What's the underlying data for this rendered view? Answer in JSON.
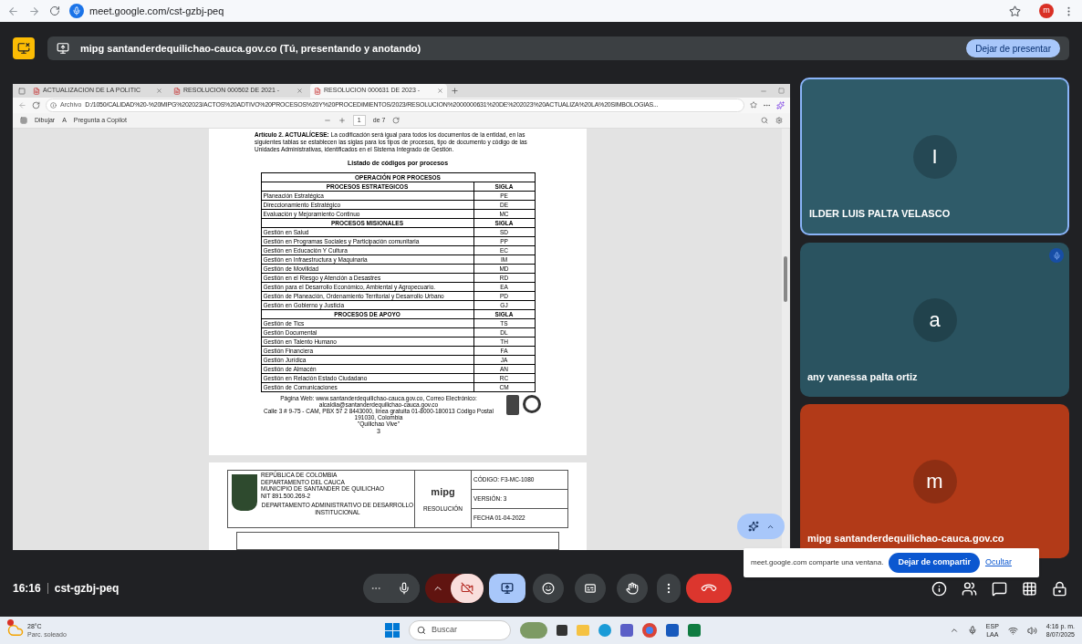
{
  "browser": {
    "url": "meet.google.com/cst-gzbj-peq",
    "profile_initial": "m"
  },
  "presenting_bar": {
    "text": "mipg santanderdequilichao-cauca.gov.co (Tú, presentando y anotando)",
    "button": "Dejar de presentar"
  },
  "shared_window": {
    "tabs": [
      {
        "label": "ACTUALIZACION DE LA POLITIC",
        "selected": false
      },
      {
        "label": "RESOLUCION 000502 DE 2021 -",
        "selected": false
      },
      {
        "label": "RESOLUCION 000631 DE 2023 -",
        "selected": true
      }
    ],
    "address_label": "Archivo",
    "address": "D:/1050/CALIDAD%20-%20MIPG%202023/ACTOS%20ADTIVO%20PROCESOS%20Y%20PROCEDIMIENTOS/2023/RESOLUCION%2000000631%20DE%202023%20ACTUALIZA%20LA%20SIMBOLOGIAS...",
    "pdf_toolbar": {
      "draw": "Dibujar",
      "read_aloud": "A",
      "copilot": "Pregunta a Copilot",
      "page": "1",
      "page_count": "de 7"
    },
    "page": {
      "intro": "**Artículo 2. ACTUALÍCESE:** La codificación será igual para todos los documentos de la entidad, en las siguientes tablas se establecen las siglas para los tipos de procesos, tipo de documento y código de las Unidades Administrativas, identificados en el Sistema Integrado de Gestión.",
      "heading": "Listado de códigos por procesos",
      "table_title": "OPERACIÓN POR PROCESOS",
      "sections": [
        {
          "name": "PROCESOS ESTRATEGICOS",
          "code_header": "SIGLA",
          "rows": [
            {
              "name": "Planeación Estratégica",
              "code": "PE"
            },
            {
              "name": "Direccionamiento Estratégico",
              "code": "DE"
            },
            {
              "name": "Evaluación y Mejoramiento Continuo",
              "code": "MC"
            }
          ]
        },
        {
          "name": "PROCESOS MISIONALES",
          "code_header": "SIGLA",
          "rows": [
            {
              "name": "Gestión en Salud",
              "code": "SD"
            },
            {
              "name": "Gestión en Programas Sociales y Participación comunitaria",
              "code": "PP"
            },
            {
              "name": "Gestión en Educación Y Cultura",
              "code": "EC"
            },
            {
              "name": "Gestión en Infraestructura y Maquinaria",
              "code": "IM"
            },
            {
              "name": "Gestión de Movilidad",
              "code": "MD"
            },
            {
              "name": "Gestión en el Riesgo y Atención a Desastres",
              "code": "RD"
            },
            {
              "name": "Gestión para el Desarrollo Económico, Ambiental y Agropecuario.",
              "code": "EA"
            },
            {
              "name": "Gestión de Planeación, Ordenamiento Territorial y Desarrollo Urbano",
              "code": "PD"
            },
            {
              "name": "Gestión en Gobierno y Justicia",
              "code": "GJ"
            }
          ]
        },
        {
          "name": "PROCESOS DE APOYO",
          "code_header": "SIGLA",
          "rows": [
            {
              "name": "Gestión de Tics",
              "code": "TS"
            },
            {
              "name": "Gestión Documental",
              "code": "DL"
            },
            {
              "name": "Gestión en Talento Humano",
              "code": "TH"
            },
            {
              "name": "Gestión Financiera",
              "code": "FA"
            },
            {
              "name": "Gestión Jurídica",
              "code": "JA"
            },
            {
              "name": "Gestión de Almacén",
              "code": "AN"
            },
            {
              "name": "Gestión en Relación Estado Ciudadano",
              "code": "RC"
            },
            {
              "name": "Gestión de Comunicaciones",
              "code": "CM"
            }
          ]
        }
      ],
      "footer": [
        "Página Web: www.santanderdequilichao-cauca.gov.co, Correo Electrónico: alcaldia@santanderdequilichao-cauca.gov.co",
        "Calle 3 # 9-75 - CAM, PBX 57 2 8443000, línea gratuita 01-8000-180013 Código Postal 191030, Colombia",
        "\"Quilichao Vive\""
      ],
      "page_number": "3"
    },
    "next_page": {
      "header_lines": [
        "REPÚBLICA DE COLOMBIA",
        "DEPARTAMENTO DEL CAUCA",
        "MUNICIPIO DE SANTANDER DE QUILICHAO",
        "NIT 891.500.269-2"
      ],
      "department": "DEPARTAMENTO ADMINISTRATIVO DE DESARROLLO INSTITUCIONAL",
      "logo": "mipg",
      "doc_type": "RESOLUCIÓN",
      "meta": [
        "CÓDIGO: F3-MC-1080",
        "VERSIÓN: 3",
        "FECHA 01-04-2022"
      ]
    }
  },
  "tiles": [
    {
      "initial": "I",
      "name": "ILDER LUIS PALTA VELASCO",
      "color": "#2f5b69",
      "highlighted": true,
      "audio_indicator": false
    },
    {
      "initial": "a",
      "name": "any vanessa palta ortiz",
      "color": "#2a5360",
      "highlighted": false,
      "audio_indicator": true
    },
    {
      "initial": "m",
      "name": "mipg santanderdequilichao-cauca.gov.co",
      "color": "#b23a18",
      "highlighted": false,
      "audio_indicator": false
    }
  ],
  "notification": {
    "text": "meet.google.com comparte una ventana.",
    "button": "Dejar de compartir",
    "link": "Ocultar"
  },
  "meeting": {
    "time": "16:16",
    "code": "cst-gzbj-peq",
    "mic_on": true,
    "camera_on": false
  },
  "taskbar": {
    "temperature": "28°C",
    "weather": "Parc. soleado",
    "search": "Buscar",
    "language": "ESP",
    "layout": "LAA",
    "time": "4:16 p. m.",
    "date": "8/07/2025"
  }
}
